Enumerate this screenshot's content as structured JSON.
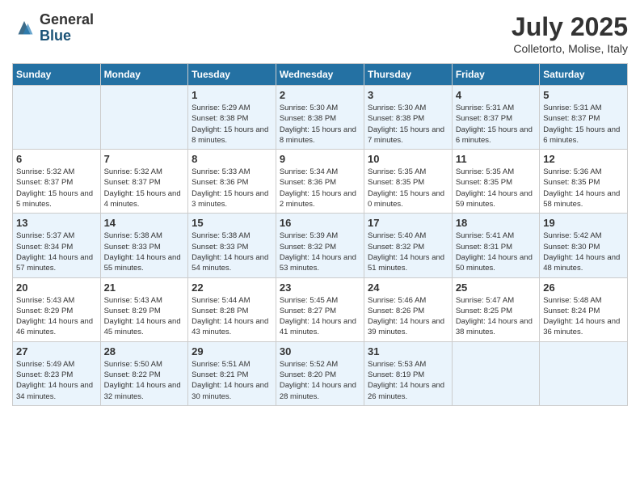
{
  "logo": {
    "general": "General",
    "blue": "Blue"
  },
  "title": "July 2025",
  "location": "Colletorto, Molise, Italy",
  "days_of_week": [
    "Sunday",
    "Monday",
    "Tuesday",
    "Wednesday",
    "Thursday",
    "Friday",
    "Saturday"
  ],
  "weeks": [
    [
      {
        "day": "",
        "info": ""
      },
      {
        "day": "",
        "info": ""
      },
      {
        "day": "1",
        "info": "Sunrise: 5:29 AM\nSunset: 8:38 PM\nDaylight: 15 hours and 8 minutes."
      },
      {
        "day": "2",
        "info": "Sunrise: 5:30 AM\nSunset: 8:38 PM\nDaylight: 15 hours and 8 minutes."
      },
      {
        "day": "3",
        "info": "Sunrise: 5:30 AM\nSunset: 8:38 PM\nDaylight: 15 hours and 7 minutes."
      },
      {
        "day": "4",
        "info": "Sunrise: 5:31 AM\nSunset: 8:37 PM\nDaylight: 15 hours and 6 minutes."
      },
      {
        "day": "5",
        "info": "Sunrise: 5:31 AM\nSunset: 8:37 PM\nDaylight: 15 hours and 6 minutes."
      }
    ],
    [
      {
        "day": "6",
        "info": "Sunrise: 5:32 AM\nSunset: 8:37 PM\nDaylight: 15 hours and 5 minutes."
      },
      {
        "day": "7",
        "info": "Sunrise: 5:32 AM\nSunset: 8:37 PM\nDaylight: 15 hours and 4 minutes."
      },
      {
        "day": "8",
        "info": "Sunrise: 5:33 AM\nSunset: 8:36 PM\nDaylight: 15 hours and 3 minutes."
      },
      {
        "day": "9",
        "info": "Sunrise: 5:34 AM\nSunset: 8:36 PM\nDaylight: 15 hours and 2 minutes."
      },
      {
        "day": "10",
        "info": "Sunrise: 5:35 AM\nSunset: 8:35 PM\nDaylight: 15 hours and 0 minutes."
      },
      {
        "day": "11",
        "info": "Sunrise: 5:35 AM\nSunset: 8:35 PM\nDaylight: 14 hours and 59 minutes."
      },
      {
        "day": "12",
        "info": "Sunrise: 5:36 AM\nSunset: 8:35 PM\nDaylight: 14 hours and 58 minutes."
      }
    ],
    [
      {
        "day": "13",
        "info": "Sunrise: 5:37 AM\nSunset: 8:34 PM\nDaylight: 14 hours and 57 minutes."
      },
      {
        "day": "14",
        "info": "Sunrise: 5:38 AM\nSunset: 8:33 PM\nDaylight: 14 hours and 55 minutes."
      },
      {
        "day": "15",
        "info": "Sunrise: 5:38 AM\nSunset: 8:33 PM\nDaylight: 14 hours and 54 minutes."
      },
      {
        "day": "16",
        "info": "Sunrise: 5:39 AM\nSunset: 8:32 PM\nDaylight: 14 hours and 53 minutes."
      },
      {
        "day": "17",
        "info": "Sunrise: 5:40 AM\nSunset: 8:32 PM\nDaylight: 14 hours and 51 minutes."
      },
      {
        "day": "18",
        "info": "Sunrise: 5:41 AM\nSunset: 8:31 PM\nDaylight: 14 hours and 50 minutes."
      },
      {
        "day": "19",
        "info": "Sunrise: 5:42 AM\nSunset: 8:30 PM\nDaylight: 14 hours and 48 minutes."
      }
    ],
    [
      {
        "day": "20",
        "info": "Sunrise: 5:43 AM\nSunset: 8:29 PM\nDaylight: 14 hours and 46 minutes."
      },
      {
        "day": "21",
        "info": "Sunrise: 5:43 AM\nSunset: 8:29 PM\nDaylight: 14 hours and 45 minutes."
      },
      {
        "day": "22",
        "info": "Sunrise: 5:44 AM\nSunset: 8:28 PM\nDaylight: 14 hours and 43 minutes."
      },
      {
        "day": "23",
        "info": "Sunrise: 5:45 AM\nSunset: 8:27 PM\nDaylight: 14 hours and 41 minutes."
      },
      {
        "day": "24",
        "info": "Sunrise: 5:46 AM\nSunset: 8:26 PM\nDaylight: 14 hours and 39 minutes."
      },
      {
        "day": "25",
        "info": "Sunrise: 5:47 AM\nSunset: 8:25 PM\nDaylight: 14 hours and 38 minutes."
      },
      {
        "day": "26",
        "info": "Sunrise: 5:48 AM\nSunset: 8:24 PM\nDaylight: 14 hours and 36 minutes."
      }
    ],
    [
      {
        "day": "27",
        "info": "Sunrise: 5:49 AM\nSunset: 8:23 PM\nDaylight: 14 hours and 34 minutes."
      },
      {
        "day": "28",
        "info": "Sunrise: 5:50 AM\nSunset: 8:22 PM\nDaylight: 14 hours and 32 minutes."
      },
      {
        "day": "29",
        "info": "Sunrise: 5:51 AM\nSunset: 8:21 PM\nDaylight: 14 hours and 30 minutes."
      },
      {
        "day": "30",
        "info": "Sunrise: 5:52 AM\nSunset: 8:20 PM\nDaylight: 14 hours and 28 minutes."
      },
      {
        "day": "31",
        "info": "Sunrise: 5:53 AM\nSunset: 8:19 PM\nDaylight: 14 hours and 26 minutes."
      },
      {
        "day": "",
        "info": ""
      },
      {
        "day": "",
        "info": ""
      }
    ]
  ]
}
